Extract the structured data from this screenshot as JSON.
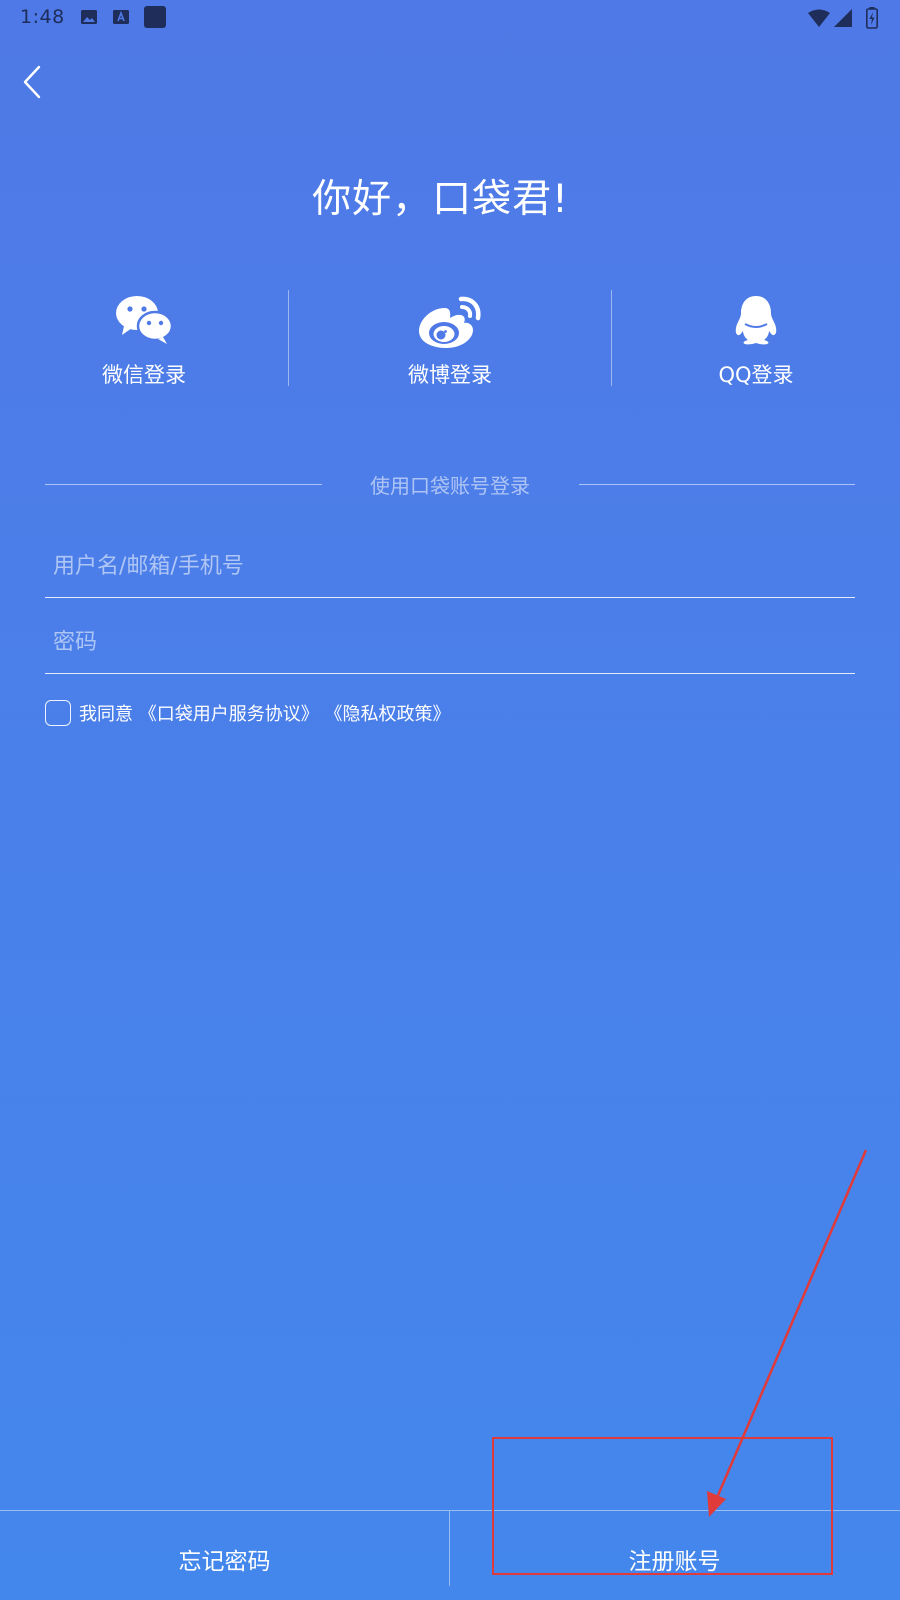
{
  "status_bar": {
    "time": "1:48"
  },
  "header": {
    "back_icon": "chevron-left-icon"
  },
  "title": "你好，口袋君!",
  "social_login": {
    "items": [
      {
        "label": "微信登录",
        "icon": "wechat-icon"
      },
      {
        "label": "微博登录",
        "icon": "weibo-icon"
      },
      {
        "label": "QQ登录",
        "icon": "qq-icon"
      }
    ]
  },
  "account_login": {
    "caption": "使用口袋账号登录",
    "username_placeholder": "用户名/邮箱/手机号",
    "username_value": "",
    "password_placeholder": "密码",
    "password_value": ""
  },
  "agreement": {
    "checked": false,
    "prefix": "我同意",
    "terms_link": "《口袋用户服务协议》",
    "privacy_link": "《隐私权政策》"
  },
  "bottom_bar": {
    "forgot_password": "忘记密码",
    "register": "注册账号"
  },
  "colors": {
    "background_top": "#4f79e6",
    "background_bottom": "#4387ec",
    "annotation": "#e03a3a",
    "status_text": "#1e2d5a"
  }
}
